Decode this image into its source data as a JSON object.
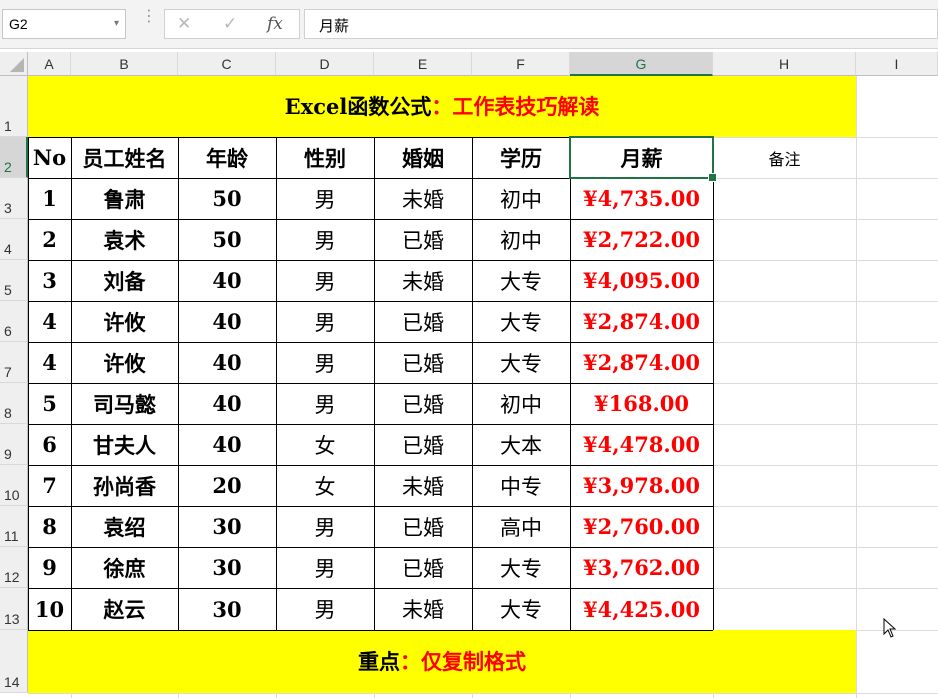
{
  "formula_bar": {
    "name_box": "G2",
    "cancel_icon": "✕",
    "enter_icon": "✓",
    "fx_label": "fx",
    "content": "月薪"
  },
  "columns": [
    "A",
    "B",
    "C",
    "D",
    "E",
    "F",
    "G",
    "H",
    "I"
  ],
  "rows": [
    "1",
    "2",
    "3",
    "4",
    "5",
    "6",
    "7",
    "8",
    "9",
    "10",
    "11",
    "12",
    "13",
    "14"
  ],
  "title_banner": {
    "black": "Excel函数公式",
    "red": "：工作表技巧解读"
  },
  "table": {
    "headers": [
      "No",
      "员工姓名",
      "年龄",
      "性别",
      "婚姻",
      "学历",
      "月薪"
    ],
    "rows": [
      [
        "1",
        "鲁肃",
        "50",
        "男",
        "未婚",
        "初中",
        "¥4,735.00"
      ],
      [
        "2",
        "袁术",
        "50",
        "男",
        "已婚",
        "初中",
        "¥2,722.00"
      ],
      [
        "3",
        "刘备",
        "40",
        "男",
        "未婚",
        "大专",
        "¥4,095.00"
      ],
      [
        "4",
        "许攸",
        "40",
        "男",
        "已婚",
        "大专",
        "¥2,874.00"
      ],
      [
        "4",
        "许攸",
        "40",
        "男",
        "已婚",
        "大专",
        "¥2,874.00"
      ],
      [
        "5",
        "司马懿",
        "40",
        "男",
        "已婚",
        "初中",
        "¥168.00"
      ],
      [
        "6",
        "甘夫人",
        "40",
        "女",
        "已婚",
        "大本",
        "¥4,478.00"
      ],
      [
        "7",
        "孙尚香",
        "20",
        "女",
        "未婚",
        "中专",
        "¥3,978.00"
      ],
      [
        "8",
        "袁绍",
        "30",
        "男",
        "已婚",
        "高中",
        "¥2,760.00"
      ],
      [
        "9",
        "徐庶",
        "30",
        "男",
        "已婚",
        "大专",
        "¥3,762.00"
      ],
      [
        "10",
        "赵云",
        "30",
        "男",
        "未婚",
        "大专",
        "¥4,425.00"
      ]
    ]
  },
  "remark_header": "备注",
  "footer_banner": {
    "black": "重点",
    "red": "：仅复制格式"
  },
  "colors": {
    "banner": "#ffff00",
    "salary": "#ff0000",
    "selection": "#217346"
  }
}
